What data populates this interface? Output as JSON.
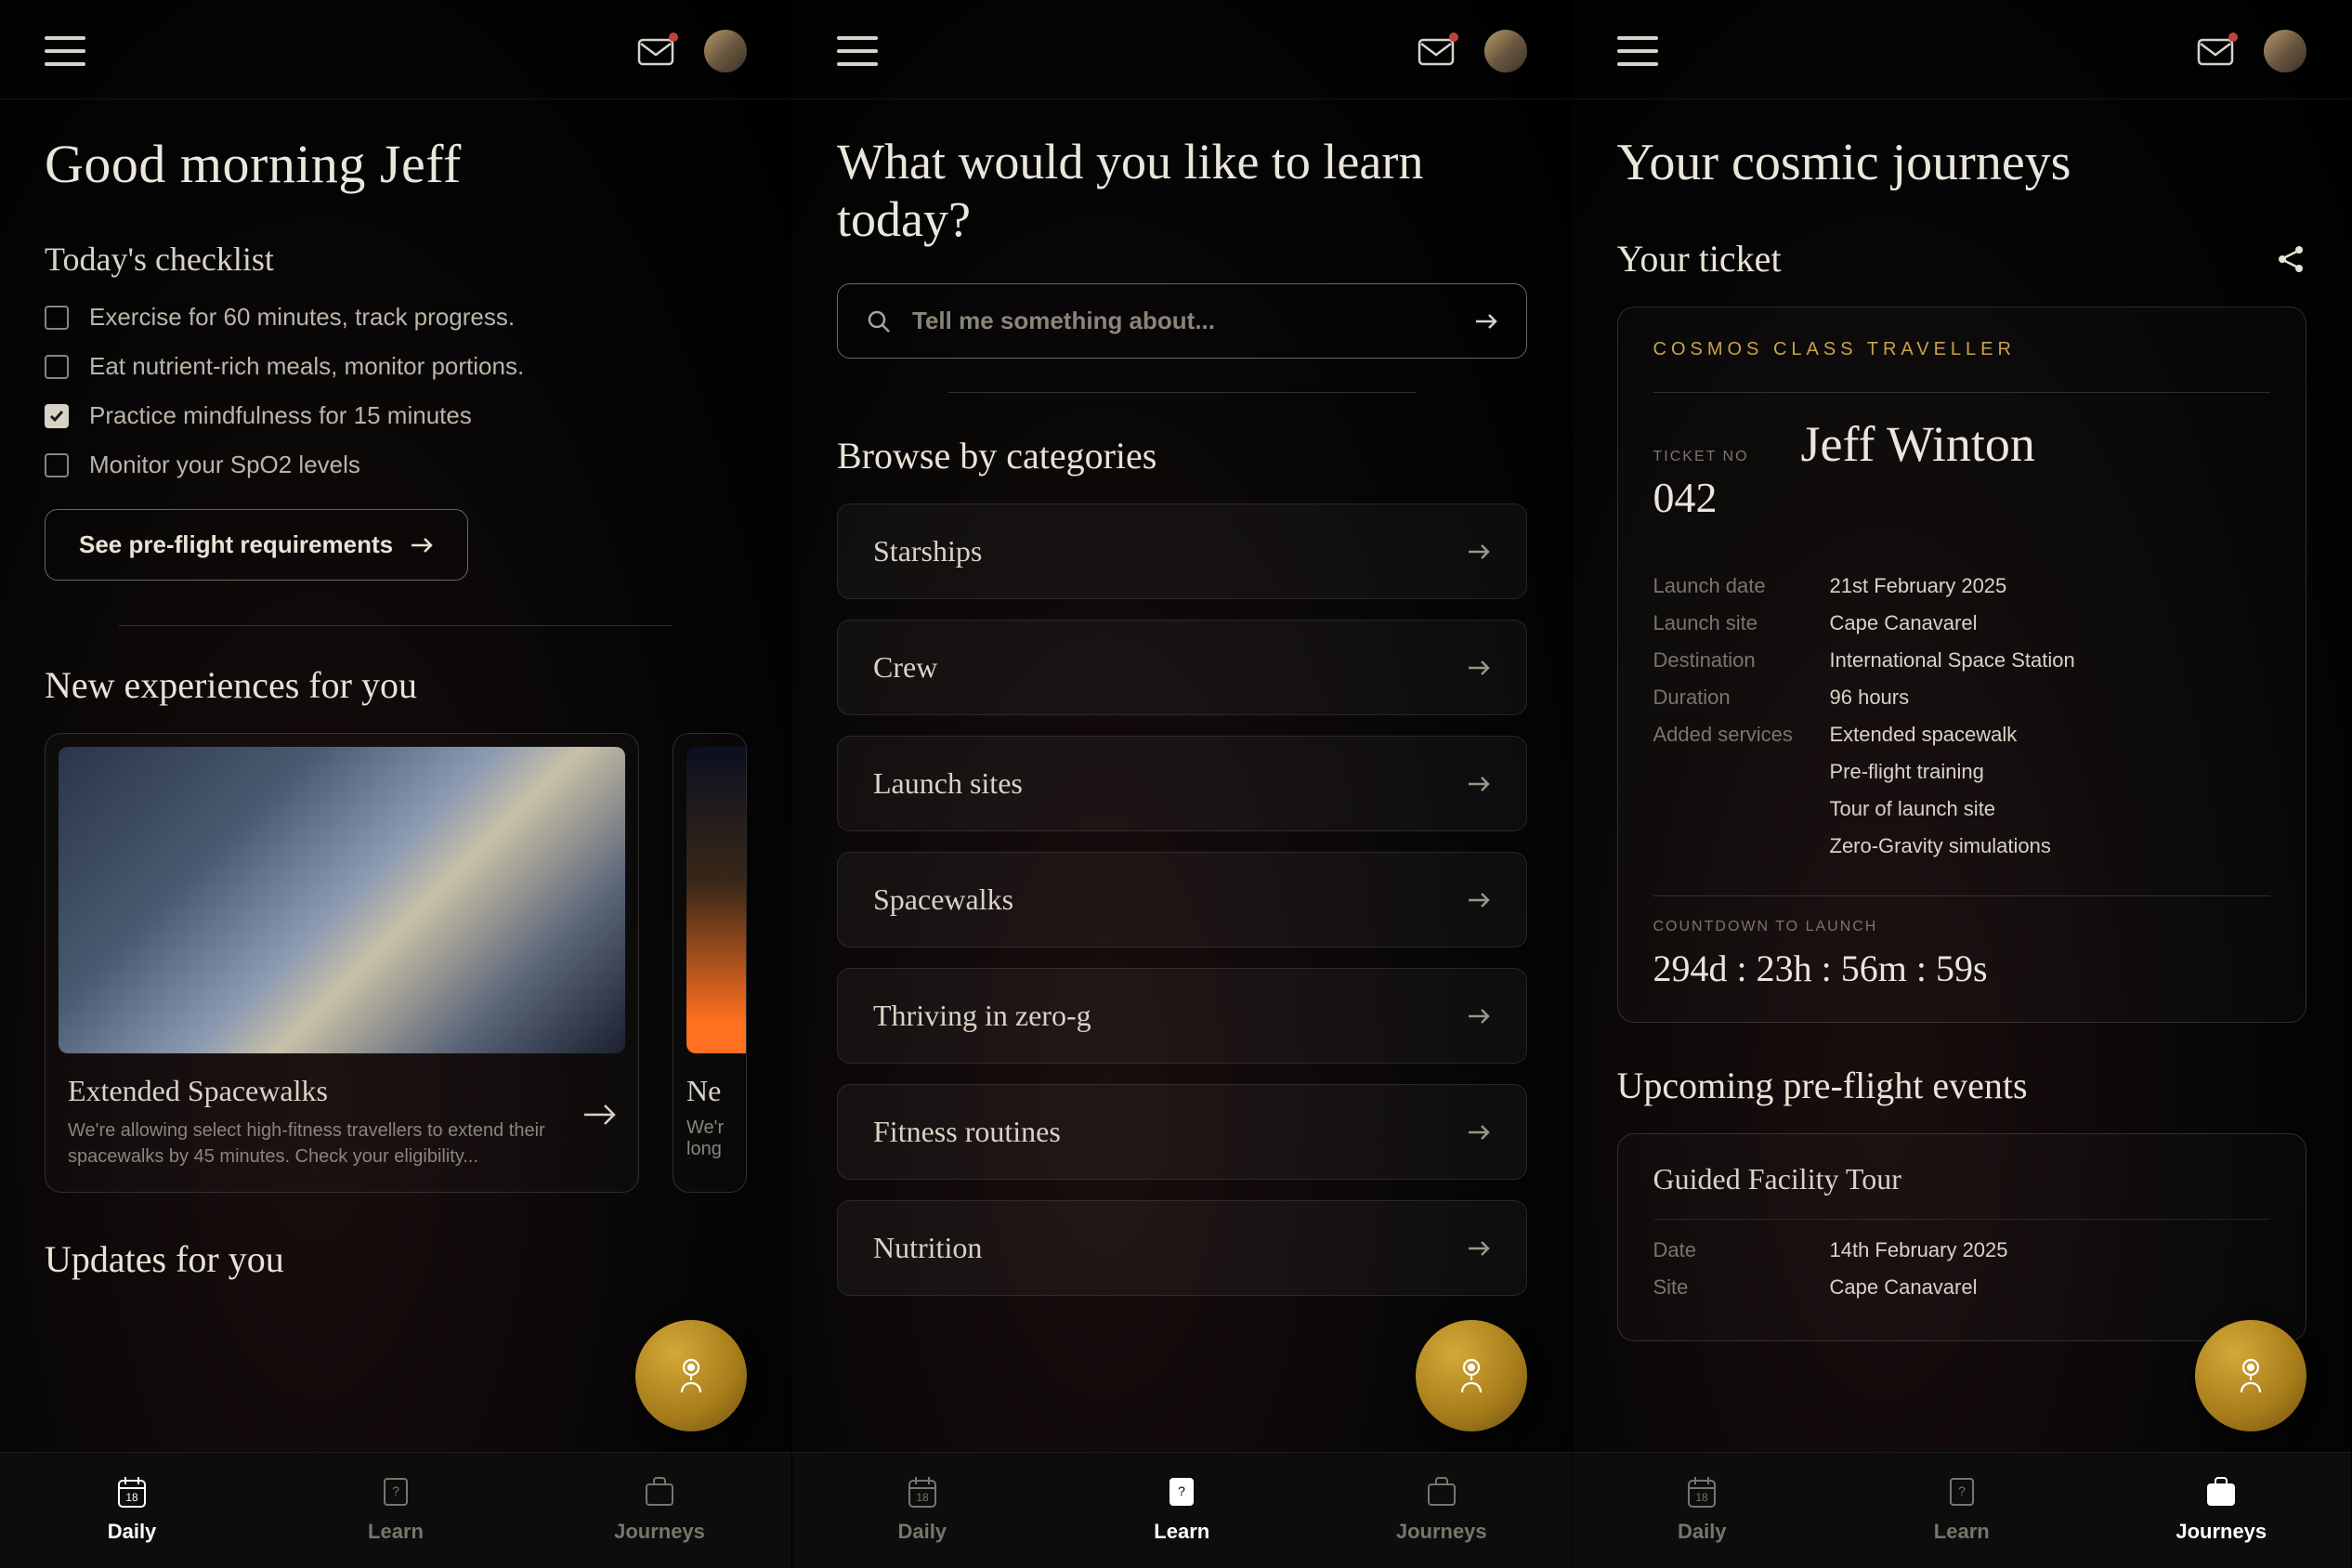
{
  "screens": {
    "daily": {
      "greeting": "Good morning Jeff",
      "checklist_heading": "Today's checklist",
      "checklist": [
        {
          "label": "Exercise for 60 minutes, track progress.",
          "checked": false
        },
        {
          "label": "Eat nutrient-rich meals, monitor portions.",
          "checked": false
        },
        {
          "label": "Practice mindfulness for 15 minutes",
          "checked": true
        },
        {
          "label": "Monitor your SpO2 levels",
          "checked": false
        }
      ],
      "preflight_button": "See pre-flight requirements",
      "experiences_heading": "New experiences for you",
      "experience_card": {
        "title": "Extended Spacewalks",
        "desc": "We're allowing select high-fitness travellers to extend their spacewalks by 45 minutes. Check your eligibility..."
      },
      "peek_card": {
        "title": "Ne",
        "desc": "We'r",
        "desc2": "long"
      },
      "updates_heading": "Updates for you"
    },
    "learn": {
      "title": "What would you like to learn today?",
      "search_placeholder": "Tell me something about...",
      "browse_heading": "Browse by categories",
      "categories": [
        "Starships",
        "Crew",
        "Launch sites",
        "Spacewalks",
        "Thriving in zero-g",
        "Fitness routines",
        "Nutrition"
      ]
    },
    "journeys": {
      "title": "Your cosmic journeys",
      "ticket_heading": "Your ticket",
      "ticket": {
        "class_label": "COSMOS CLASS TRAVELLER",
        "ticket_no_label": "TICKET NO",
        "ticket_no": "042",
        "name": "Jeff Winton",
        "details": [
          {
            "label": "Launch date",
            "value": "21st February 2025"
          },
          {
            "label": "Launch site",
            "value": "Cape Canavarel"
          },
          {
            "label": "Destination",
            "value": "International Space Station"
          },
          {
            "label": "Duration",
            "value": "96 hours"
          },
          {
            "label": "Added services",
            "value": "Extended spacewalk"
          },
          {
            "label": "",
            "value": "Pre-flight training"
          },
          {
            "label": "",
            "value": "Tour of launch site"
          },
          {
            "label": "",
            "value": "Zero-Gravity simulations"
          }
        ],
        "countdown_label": "COUNTDOWN TO LAUNCH",
        "countdown": "294d : 23h : 56m : 59s"
      },
      "events_heading": "Upcoming pre-flight events",
      "event": {
        "title": "Guided Facility Tour",
        "rows": [
          {
            "label": "Date",
            "value": "14th February 2025"
          },
          {
            "label": "Site",
            "value": "Cape Canavarel"
          }
        ]
      }
    }
  },
  "nav": {
    "daily": "Daily",
    "learn": "Learn",
    "journeys": "Journeys"
  }
}
